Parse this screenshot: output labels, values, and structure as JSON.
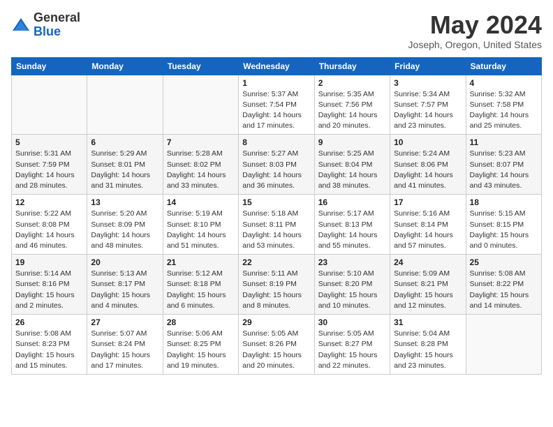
{
  "header": {
    "logo_general": "General",
    "logo_blue": "Blue",
    "month": "May 2024",
    "location": "Joseph, Oregon, United States"
  },
  "weekdays": [
    "Sunday",
    "Monday",
    "Tuesday",
    "Wednesday",
    "Thursday",
    "Friday",
    "Saturday"
  ],
  "weeks": [
    [
      {
        "day": "",
        "info": ""
      },
      {
        "day": "",
        "info": ""
      },
      {
        "day": "",
        "info": ""
      },
      {
        "day": "1",
        "info": "Sunrise: 5:37 AM\nSunset: 7:54 PM\nDaylight: 14 hours\nand 17 minutes."
      },
      {
        "day": "2",
        "info": "Sunrise: 5:35 AM\nSunset: 7:56 PM\nDaylight: 14 hours\nand 20 minutes."
      },
      {
        "day": "3",
        "info": "Sunrise: 5:34 AM\nSunset: 7:57 PM\nDaylight: 14 hours\nand 23 minutes."
      },
      {
        "day": "4",
        "info": "Sunrise: 5:32 AM\nSunset: 7:58 PM\nDaylight: 14 hours\nand 25 minutes."
      }
    ],
    [
      {
        "day": "5",
        "info": "Sunrise: 5:31 AM\nSunset: 7:59 PM\nDaylight: 14 hours\nand 28 minutes."
      },
      {
        "day": "6",
        "info": "Sunrise: 5:29 AM\nSunset: 8:01 PM\nDaylight: 14 hours\nand 31 minutes."
      },
      {
        "day": "7",
        "info": "Sunrise: 5:28 AM\nSunset: 8:02 PM\nDaylight: 14 hours\nand 33 minutes."
      },
      {
        "day": "8",
        "info": "Sunrise: 5:27 AM\nSunset: 8:03 PM\nDaylight: 14 hours\nand 36 minutes."
      },
      {
        "day": "9",
        "info": "Sunrise: 5:25 AM\nSunset: 8:04 PM\nDaylight: 14 hours\nand 38 minutes."
      },
      {
        "day": "10",
        "info": "Sunrise: 5:24 AM\nSunset: 8:06 PM\nDaylight: 14 hours\nand 41 minutes."
      },
      {
        "day": "11",
        "info": "Sunrise: 5:23 AM\nSunset: 8:07 PM\nDaylight: 14 hours\nand 43 minutes."
      }
    ],
    [
      {
        "day": "12",
        "info": "Sunrise: 5:22 AM\nSunset: 8:08 PM\nDaylight: 14 hours\nand 46 minutes."
      },
      {
        "day": "13",
        "info": "Sunrise: 5:20 AM\nSunset: 8:09 PM\nDaylight: 14 hours\nand 48 minutes."
      },
      {
        "day": "14",
        "info": "Sunrise: 5:19 AM\nSunset: 8:10 PM\nDaylight: 14 hours\nand 51 minutes."
      },
      {
        "day": "15",
        "info": "Sunrise: 5:18 AM\nSunset: 8:11 PM\nDaylight: 14 hours\nand 53 minutes."
      },
      {
        "day": "16",
        "info": "Sunrise: 5:17 AM\nSunset: 8:13 PM\nDaylight: 14 hours\nand 55 minutes."
      },
      {
        "day": "17",
        "info": "Sunrise: 5:16 AM\nSunset: 8:14 PM\nDaylight: 14 hours\nand 57 minutes."
      },
      {
        "day": "18",
        "info": "Sunrise: 5:15 AM\nSunset: 8:15 PM\nDaylight: 15 hours\nand 0 minutes."
      }
    ],
    [
      {
        "day": "19",
        "info": "Sunrise: 5:14 AM\nSunset: 8:16 PM\nDaylight: 15 hours\nand 2 minutes."
      },
      {
        "day": "20",
        "info": "Sunrise: 5:13 AM\nSunset: 8:17 PM\nDaylight: 15 hours\nand 4 minutes."
      },
      {
        "day": "21",
        "info": "Sunrise: 5:12 AM\nSunset: 8:18 PM\nDaylight: 15 hours\nand 6 minutes."
      },
      {
        "day": "22",
        "info": "Sunrise: 5:11 AM\nSunset: 8:19 PM\nDaylight: 15 hours\nand 8 minutes."
      },
      {
        "day": "23",
        "info": "Sunrise: 5:10 AM\nSunset: 8:20 PM\nDaylight: 15 hours\nand 10 minutes."
      },
      {
        "day": "24",
        "info": "Sunrise: 5:09 AM\nSunset: 8:21 PM\nDaylight: 15 hours\nand 12 minutes."
      },
      {
        "day": "25",
        "info": "Sunrise: 5:08 AM\nSunset: 8:22 PM\nDaylight: 15 hours\nand 14 minutes."
      }
    ],
    [
      {
        "day": "26",
        "info": "Sunrise: 5:08 AM\nSunset: 8:23 PM\nDaylight: 15 hours\nand 15 minutes."
      },
      {
        "day": "27",
        "info": "Sunrise: 5:07 AM\nSunset: 8:24 PM\nDaylight: 15 hours\nand 17 minutes."
      },
      {
        "day": "28",
        "info": "Sunrise: 5:06 AM\nSunset: 8:25 PM\nDaylight: 15 hours\nand 19 minutes."
      },
      {
        "day": "29",
        "info": "Sunrise: 5:05 AM\nSunset: 8:26 PM\nDaylight: 15 hours\nand 20 minutes."
      },
      {
        "day": "30",
        "info": "Sunrise: 5:05 AM\nSunset: 8:27 PM\nDaylight: 15 hours\nand 22 minutes."
      },
      {
        "day": "31",
        "info": "Sunrise: 5:04 AM\nSunset: 8:28 PM\nDaylight: 15 hours\nand 23 minutes."
      },
      {
        "day": "",
        "info": ""
      }
    ]
  ]
}
